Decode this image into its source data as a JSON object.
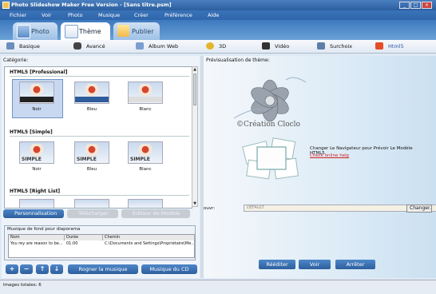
{
  "window": {
    "title": "Photo Slideshow Maker Free Version - [Sans titre.psm]"
  },
  "menu": [
    "Fichier",
    "Voir",
    "Photo",
    "Musique",
    "Créer",
    "Préférence",
    "Aide"
  ],
  "main_tabs": [
    {
      "label": "Photo",
      "active": false
    },
    {
      "label": "Thème",
      "active": true
    },
    {
      "label": "Publier",
      "active": false
    }
  ],
  "sub_tabs": [
    {
      "label": "Basique",
      "icon": "basic-icon"
    },
    {
      "label": "Avancé",
      "icon": "camera-icon"
    },
    {
      "label": "Album Web",
      "icon": "web-album-icon"
    },
    {
      "label": "3D",
      "icon": "3d-icon"
    },
    {
      "label": "Vidéo",
      "icon": "film-icon"
    },
    {
      "label": "Surchoix",
      "icon": "surchoix-icon"
    },
    {
      "label": "Html5",
      "icon": "html5-icon",
      "active": true
    }
  ],
  "left": {
    "category_label": "Catégorie:",
    "sections": [
      {
        "title": "HTML5 [Professional]",
        "items": [
          "Noir",
          "Bleu",
          "Blanc"
        ]
      },
      {
        "title": "HTML5 [Simple]",
        "items": [
          "Noir",
          "Bleu",
          "Blanc"
        ]
      },
      {
        "title": "HTML5 [Right List]"
      }
    ],
    "buttons": {
      "personalize": "Personnalisation",
      "download": "Télécharger",
      "editor": "Editeur de Modèle"
    },
    "music": {
      "legend": "Musique de fond pour diaporama",
      "columns": [
        "Nom",
        "Durée",
        "Chemin"
      ],
      "rows": [
        {
          "name": "You rey are reason to be...",
          "duration": "01:00",
          "path": "C:\\Documents and Settings\\Propriétaire\\Me..."
        }
      ],
      "trim_label": "Rogner la musique",
      "cd_label": "Musique du CD"
    }
  },
  "right": {
    "preview_label": "Prévisualisation de thème:",
    "brand": "©Création Cloclo",
    "change_text": "Changer Le Navigateur pour Prévoir Le Modèle HTML5.",
    "help_link": "Check online help",
    "link_label": "ouvr:",
    "link_value": "DEFAULT",
    "change_button": "Changer.",
    "buttons": {
      "replay": "Rééditer",
      "view": "Voir",
      "stop": "Arrêter"
    }
  },
  "status": {
    "images_total": "Images totales: 6"
  },
  "colors": {
    "titlebar": "#2b5e9e",
    "accent": "#3d79bf",
    "link": "#cc2222"
  }
}
